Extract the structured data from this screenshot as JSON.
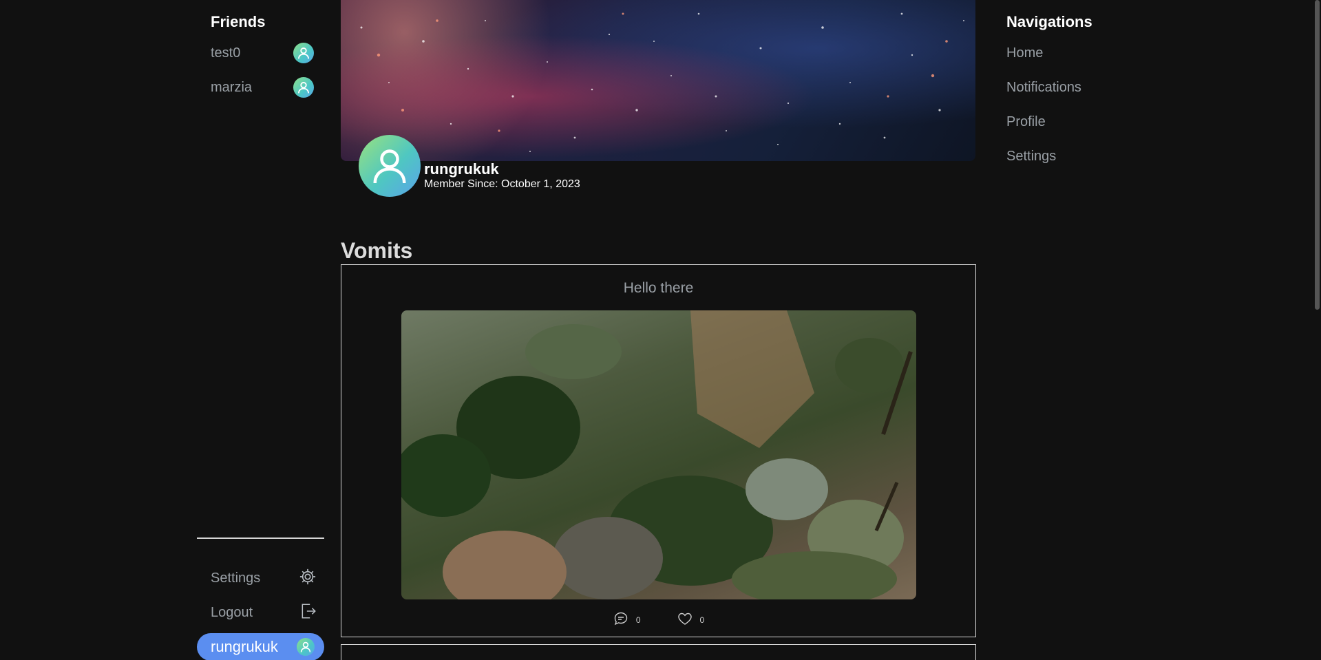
{
  "friends": {
    "heading": "Friends",
    "items": [
      {
        "name": "test0",
        "icon": "user-avatar-icon"
      },
      {
        "name": "marzia",
        "icon": "user-avatar-icon"
      }
    ]
  },
  "sidebar_bottom": {
    "settings_label": "Settings",
    "settings_icon": "gear-icon",
    "logout_label": "Logout",
    "logout_icon": "logout-icon",
    "current_user": "rungrukuk"
  },
  "profile": {
    "username": "rungrukuk",
    "member_since": "Member Since: October 1, 2023"
  },
  "feed": {
    "title": "Vomits",
    "posts": [
      {
        "text": "Hello there",
        "comments": "0",
        "likes": "0"
      }
    ]
  },
  "navigation": {
    "heading": "Navigations",
    "items": [
      "Home",
      "Notifications",
      "Profile",
      "Settings"
    ]
  },
  "colors": {
    "background": "#111111",
    "accent": "#5b8ef0",
    "muted_text": "#9aa0a6"
  }
}
